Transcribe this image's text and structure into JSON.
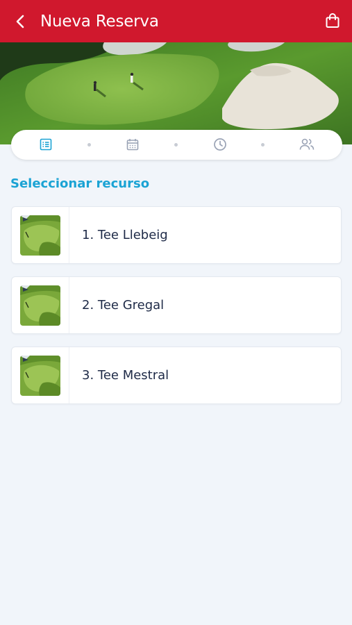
{
  "header": {
    "title": "Nueva Reserva",
    "back_icon": "chevron-left-icon",
    "cart_icon": "shopping-bag-icon",
    "bg_color": "#d0182d"
  },
  "stepper": {
    "steps": [
      {
        "icon": "list-icon",
        "active": true
      },
      {
        "icon": "calendar-icon",
        "active": false
      },
      {
        "icon": "clock-icon",
        "active": false
      },
      {
        "icon": "users-icon",
        "active": false
      }
    ],
    "active_color": "#1ba3d4",
    "inactive_color": "#9aa3b5"
  },
  "section": {
    "title": "Seleccionar recurso"
  },
  "resources": [
    {
      "label": "1. Tee Llebeig"
    },
    {
      "label": "2. Tee Gregal"
    },
    {
      "label": "3. Tee Mestral"
    }
  ]
}
